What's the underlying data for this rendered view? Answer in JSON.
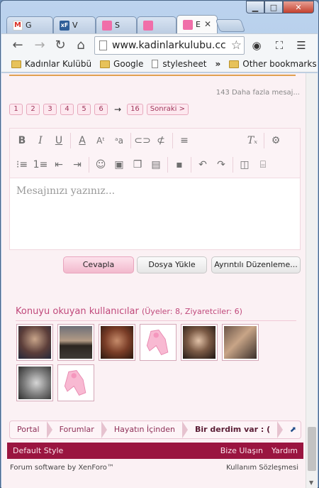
{
  "browser": {
    "tabs": [
      {
        "label": "G"
      },
      {
        "label": "V"
      },
      {
        "label": "S"
      },
      {
        "label": ""
      },
      {
        "label": "E"
      }
    ],
    "url": "www.kadinlarkulubu.cc",
    "bookmarks": [
      {
        "label": "Kadınlar Kulübü",
        "icon": "folder-icon"
      },
      {
        "label": "Google",
        "icon": "folder-icon"
      },
      {
        "label": "stylesheet",
        "icon": "page-icon"
      }
    ],
    "bookmarks_more": "»",
    "other_bookmarks": "Other bookmarks"
  },
  "thread": {
    "more_messages": "143 Daha fazla mesaj...",
    "pagination": [
      "1",
      "2",
      "3",
      "4",
      "5",
      "6"
    ],
    "pagination_arrow": "→",
    "last_page": "16",
    "next_label": "Sonraki >"
  },
  "editor": {
    "placeholder": "Mesajınızı yazınız...",
    "toolbar_row1": [
      {
        "name": "bold-button",
        "glyph": "B"
      },
      {
        "name": "italic-button",
        "glyph": "I"
      },
      {
        "name": "underline-button",
        "glyph": "U"
      },
      {
        "name": "font-color-button",
        "glyph": "A"
      },
      {
        "name": "font-size-button",
        "glyph": "A:"
      },
      {
        "name": "font-family-button",
        "glyph": "a"
      },
      {
        "name": "link-button",
        "glyph": "⊂⊃"
      },
      {
        "name": "unlink-button",
        "glyph": "⊄"
      },
      {
        "name": "align-button",
        "glyph": "≡"
      },
      {
        "name": "remove-format-button",
        "glyph": "T×"
      },
      {
        "name": "options-button",
        "glyph": "⚙"
      }
    ],
    "toolbar_row2": [
      {
        "name": "bulleted-list-button",
        "glyph": "•≡"
      },
      {
        "name": "numbered-list-button",
        "glyph": "1≡"
      },
      {
        "name": "outdent-button",
        "glyph": "⇤"
      },
      {
        "name": "indent-button",
        "glyph": "⇥"
      },
      {
        "name": "smilies-button",
        "glyph": "☺"
      },
      {
        "name": "image-button",
        "glyph": "▣"
      },
      {
        "name": "media-button",
        "glyph": "❒"
      },
      {
        "name": "code-button",
        "glyph": "▤"
      },
      {
        "name": "save-draft-button",
        "glyph": "▪"
      },
      {
        "name": "undo-button",
        "glyph": "↶"
      },
      {
        "name": "redo-button",
        "glyph": "↷"
      },
      {
        "name": "toggle-bbcode-button",
        "glyph": "◫"
      },
      {
        "name": "camera-button",
        "glyph": "⌸"
      }
    ]
  },
  "actions": {
    "reply": "Cevapla",
    "upload": "Dosya Yükle",
    "advanced": "Ayrıntılı Düzenleme..."
  },
  "viewers": {
    "title": "Konuyu okuyan kullanıcılar",
    "count": "(Üyeler: 8, Ziyaretciler: 6)"
  },
  "breadcrumbs": [
    "Portal",
    "Forumlar",
    "Hayatın İçinden",
    "Bir derdim var : ("
  ],
  "footer": {
    "style": "Default Style",
    "contact": "Bize Ulaşın",
    "help": "Yardım",
    "copyright": "Forum software by XenForo™",
    "terms": "Kullanım Sözleşmesi"
  },
  "colors": {
    "accent": "#c0497b",
    "footer_bar": "#9a1540",
    "page_bg": "#fbf1f4"
  }
}
